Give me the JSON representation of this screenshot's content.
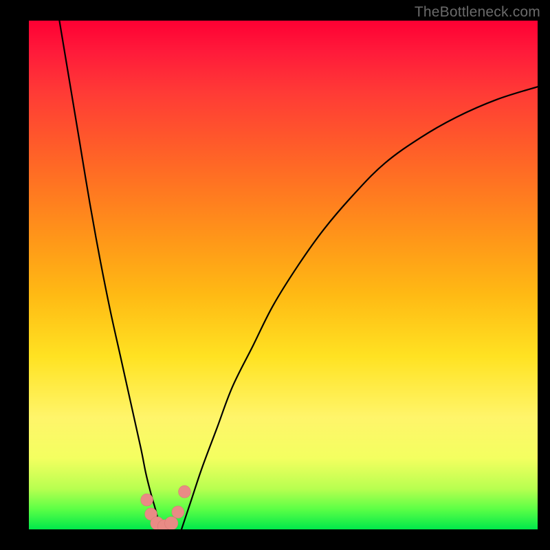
{
  "watermark": {
    "text": "TheBottleneck.com"
  },
  "chart_data": {
    "type": "line",
    "title": "",
    "xlabel": "",
    "ylabel": "",
    "xlim": [
      0,
      100
    ],
    "ylim": [
      0,
      100
    ],
    "grid": false,
    "legend": false,
    "colors": {
      "curve": "#000000",
      "marker_fill": "#e98b85",
      "marker_stroke": "#d97a74",
      "gradient_top": "#ff0033",
      "gradient_bottom": "#00e84a"
    },
    "series": [
      {
        "name": "left-branch",
        "x": [
          6,
          8,
          10,
          12,
          14,
          16,
          18,
          20,
          22,
          23,
          24,
          25,
          25.8
        ],
        "y": [
          100,
          88,
          76,
          64,
          53,
          43,
          34,
          25,
          16,
          11,
          7,
          3.5,
          0
        ]
      },
      {
        "name": "right-branch",
        "x": [
          30,
          32,
          34,
          37,
          40,
          44,
          48,
          53,
          58,
          64,
          70,
          77,
          84,
          92,
          100
        ],
        "y": [
          0,
          6,
          12,
          20,
          28,
          36,
          44,
          52,
          59,
          66,
          72,
          77,
          81,
          84.5,
          87
        ]
      }
    ],
    "markers": [
      {
        "x": 23.2,
        "y": 5.8,
        "r": 1.2
      },
      {
        "x": 24.0,
        "y": 3.0,
        "r": 1.2
      },
      {
        "x": 25.2,
        "y": 1.2,
        "r": 1.3
      },
      {
        "x": 26.6,
        "y": 0.6,
        "r": 1.3
      },
      {
        "x": 28.0,
        "y": 1.2,
        "r": 1.3
      },
      {
        "x": 29.3,
        "y": 3.4,
        "r": 1.2
      },
      {
        "x": 30.6,
        "y": 7.4,
        "r": 1.2
      }
    ]
  }
}
